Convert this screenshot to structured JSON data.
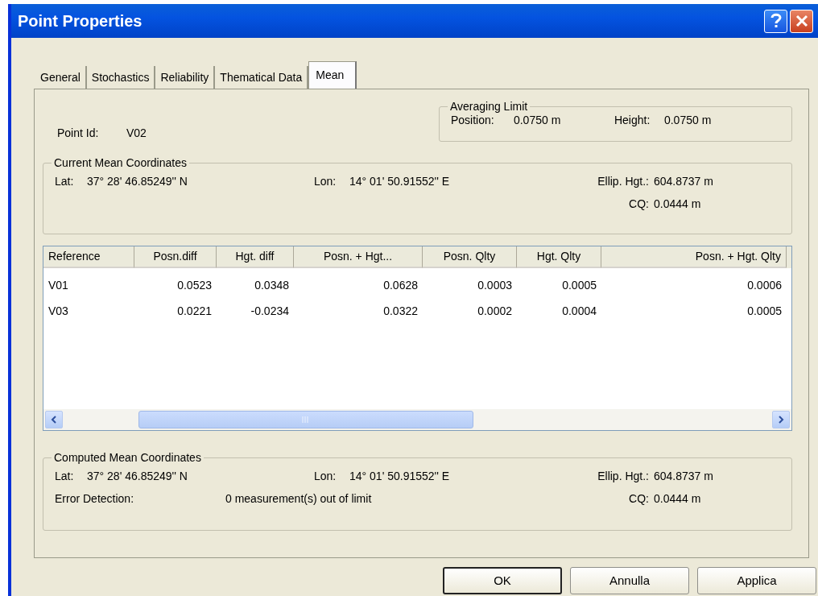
{
  "window": {
    "title": "Point Properties"
  },
  "tabs": [
    {
      "label": "General",
      "selected": false
    },
    {
      "label": "Stochastics",
      "selected": false
    },
    {
      "label": "Reliability",
      "selected": false
    },
    {
      "label": "Thematical Data",
      "selected": false
    },
    {
      "label": "Mean",
      "selected": true
    }
  ],
  "point_id": {
    "label": "Point Id:",
    "value": "V02"
  },
  "averaging_limit": {
    "title": "Averaging Limit",
    "position_label": "Position:",
    "position": "0.0750 m",
    "height_label": "Height:",
    "height": "0.0750 m"
  },
  "current_mean": {
    "title": "Current Mean Coordinates",
    "lat_label": "Lat:",
    "lat": "37° 28' 46.85249'' N",
    "lon_label": "Lon:",
    "lon": "14° 01' 50.91552'' E",
    "ellip_label": "Ellip. Hgt.:",
    "ellip": "604.8737 m",
    "cq_label": "CQ:",
    "cq": "0.0444 m"
  },
  "table": {
    "columns": [
      "Reference",
      "Posn.diff",
      "Hgt. diff",
      "Posn. + Hgt...",
      "Posn. Qlty",
      "Hgt. Qlty",
      "Posn. + Hgt. Qlty"
    ],
    "rows": [
      [
        "V01",
        "0.0523",
        "0.0348",
        "0.0628",
        "0.0003",
        "0.0005",
        "0.0006"
      ],
      [
        "V03",
        "0.0221",
        "-0.0234",
        "0.0322",
        "0.0002",
        "0.0004",
        "0.0005"
      ]
    ]
  },
  "computed_mean": {
    "title": "Computed Mean Coordinates",
    "lat_label": "Lat:",
    "lat": "37° 28' 46.85249'' N",
    "lon_label": "Lon:",
    "lon": "14° 01' 50.91552'' E",
    "ellip_label": "Ellip. Hgt.:",
    "ellip": "604.8737 m",
    "error_label": "Error Detection:",
    "error": "0 measurement(s) out of limit",
    "cq_label": "CQ:",
    "cq": "0.0444 m"
  },
  "buttons": [
    {
      "label": "OK",
      "default": true
    },
    {
      "label": "Annulla",
      "default": false
    },
    {
      "label": "Applica",
      "default": false
    }
  ]
}
